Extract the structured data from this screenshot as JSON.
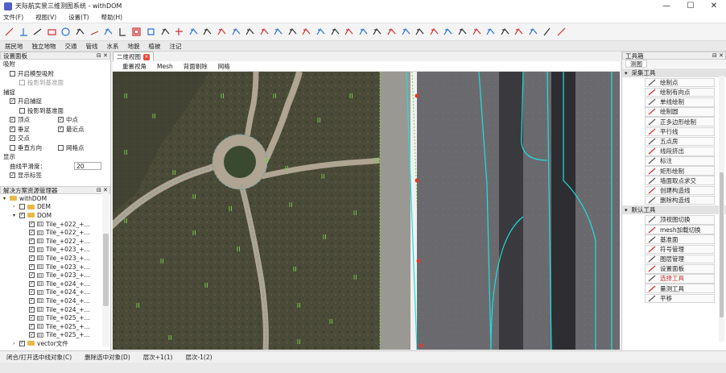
{
  "window": {
    "title": "天际航实景三维测图系统 - withDOM",
    "minimize": "—",
    "maximize": "☐",
    "close": "✕"
  },
  "menu": [
    "文件(F)",
    "视图(V)",
    "设置(T)",
    "帮助(H)"
  ],
  "toolbar_icons": [
    "point-icon",
    "perpendicular-icon",
    "line-icon",
    "rectangle-icon",
    "circle-icon",
    "hexagon-icon",
    "slant-line-icon",
    "dashed-rect-icon",
    "bracket-icon",
    "frame-icon",
    "square-icon",
    "network-icon",
    "plus-circle-icon",
    "pin-icon",
    "layers-icon",
    "select-icon",
    "eraser-icon",
    "move-icon",
    "marker-icon",
    "zoom-in-icon",
    "zoom-out-icon",
    "chat-icon",
    "mesh-icon",
    "grid-icon",
    "scatter-icon",
    "cross-icon",
    "curve-icon",
    "extend-icon",
    "join-icon",
    "zigzag-icon",
    "split-icon",
    "corner-icon",
    "scissors-icon",
    "offset-icon",
    "trim-icon",
    "flip-icon",
    "book-icon",
    "swap-icon",
    "pencil-icon",
    "diagonal-icon"
  ],
  "ribbon_tabs": [
    "居民地",
    "独立地物",
    "交通",
    "管线",
    "水系",
    "地貌",
    "植被",
    "注记"
  ],
  "settings_panel": {
    "title": "设置面板",
    "rows": [
      {
        "type": "header",
        "text": "吸附"
      },
      {
        "type": "check",
        "text": "开启模型吸附",
        "checked": false,
        "indent": 1
      },
      {
        "type": "check",
        "text": "投影到基准面",
        "checked": false,
        "indent": 2,
        "disabled": true
      },
      {
        "type": "header",
        "text": "捕捉"
      },
      {
        "type": "check",
        "text": "开启捕捉",
        "checked": true,
        "indent": 1
      },
      {
        "type": "check",
        "text": "投影到基准面",
        "checked": false,
        "indent": 2
      },
      {
        "type": "pair",
        "left": {
          "text": "顶点",
          "checked": true
        },
        "right": {
          "text": "中点",
          "checked": true
        }
      },
      {
        "type": "pair",
        "left": {
          "text": "垂足",
          "checked": true
        },
        "right": {
          "text": "最近点",
          "checked": true
        }
      },
      {
        "type": "check",
        "text": "交点",
        "checked": true,
        "indent": 1
      },
      {
        "type": "pair",
        "left": {
          "text": "垂直方向",
          "checked": false
        },
        "right": {
          "text": "网格点",
          "checked": false
        }
      },
      {
        "type": "header",
        "text": "显示"
      },
      {
        "type": "input",
        "text": "曲线平滑度：",
        "value": "20"
      },
      {
        "type": "check",
        "text": "显示标签",
        "checked": true,
        "indent": 1
      }
    ]
  },
  "explorer": {
    "title": "解决方案资源管理器",
    "items": [
      {
        "level": 0,
        "kind": "folder",
        "text": "withDOM",
        "expanded": true
      },
      {
        "level": 1,
        "kind": "folder",
        "text": "DEM",
        "checked": false
      },
      {
        "level": 1,
        "kind": "folder",
        "text": "DOM",
        "checked": true,
        "expanded": true
      },
      {
        "level": 2,
        "kind": "tile",
        "text": "Tile_+022_+..."
      },
      {
        "level": 2,
        "kind": "tile",
        "text": "Tile_+022_+..."
      },
      {
        "level": 2,
        "kind": "tile",
        "text": "Tile_+022_+..."
      },
      {
        "level": 2,
        "kind": "tile",
        "text": "Tile_+023_+..."
      },
      {
        "level": 2,
        "kind": "tile",
        "text": "Tile_+023_+..."
      },
      {
        "level": 2,
        "kind": "tile",
        "text": "Tile_+023_+..."
      },
      {
        "level": 2,
        "kind": "tile",
        "text": "Tile_+023_+..."
      },
      {
        "level": 2,
        "kind": "tile",
        "text": "Tile_+024_+..."
      },
      {
        "level": 2,
        "kind": "tile",
        "text": "Tile_+024_+..."
      },
      {
        "level": 2,
        "kind": "tile",
        "text": "Tile_+024_+..."
      },
      {
        "level": 2,
        "kind": "tile",
        "text": "Tile_+024_+..."
      },
      {
        "level": 2,
        "kind": "tile",
        "text": "Tile_+025_+..."
      },
      {
        "level": 2,
        "kind": "tile",
        "text": "Tile_+025_+..."
      },
      {
        "level": 2,
        "kind": "tile",
        "text": "Tile_+025_+..."
      },
      {
        "level": 1,
        "kind": "folder",
        "text": "vector文件",
        "checked": true,
        "expanded": false
      }
    ]
  },
  "view": {
    "tab": "二维视图",
    "tab_close": "×",
    "tools": [
      "重置视角",
      "Mesh",
      "背面剔除",
      "网格"
    ]
  },
  "toolbox": {
    "title": "工具箱",
    "tab": "测图",
    "groups": [
      {
        "name": "采集工具",
        "items": [
          {
            "label": "绘制点",
            "icon": "dot-icon"
          },
          {
            "label": "绘制有向点",
            "icon": "directed-point-icon"
          },
          {
            "label": "单线绘制",
            "icon": "line-icon"
          },
          {
            "label": "绘制圆",
            "icon": "circle-icon"
          },
          {
            "label": "正多边形绘制",
            "icon": "hexagon-icon"
          },
          {
            "label": "平行线",
            "icon": "parallel-icon"
          },
          {
            "label": "五点房",
            "icon": "dashed-rect-icon"
          },
          {
            "label": "线段挤出",
            "icon": "extrude-icon"
          },
          {
            "label": "标注",
            "icon": "label-icon"
          },
          {
            "label": "矩形绘制",
            "icon": "rectangle-icon"
          },
          {
            "label": "墙面取点求交",
            "icon": "intersect-icon"
          },
          {
            "label": "创建构造线",
            "icon": "construct-line-icon"
          },
          {
            "label": "删除构造线",
            "icon": "delete-line-icon"
          }
        ]
      },
      {
        "name": "默认工具",
        "items": [
          {
            "label": "顶视图切换",
            "icon": "topview-icon"
          },
          {
            "label": "mesh加载切换",
            "icon": "mesh-icon"
          },
          {
            "label": "基准面",
            "icon": "plane-icon"
          },
          {
            "label": "符号管理",
            "icon": "symbol-icon"
          },
          {
            "label": "图层管理",
            "icon": "layers-icon"
          },
          {
            "label": "设置面板",
            "icon": "settings-icon"
          },
          {
            "label": "选择工具",
            "icon": "select-icon",
            "highlight": true
          },
          {
            "label": "量测工具",
            "icon": "measure-icon"
          },
          {
            "label": "平移",
            "icon": "move-icon"
          }
        ]
      }
    ]
  },
  "statusbar": [
    "闭合/打开选中线对象(C)",
    "删除选中对象(D)",
    "层次+1(1)",
    "层次-1(2)"
  ],
  "colors": {
    "vector": "#1ee0e0",
    "dashed_path": "#5aa0a0",
    "snap_green": "#7cd14a",
    "highlight": "#c0302e",
    "accent_blue": "#2a6fd6"
  }
}
